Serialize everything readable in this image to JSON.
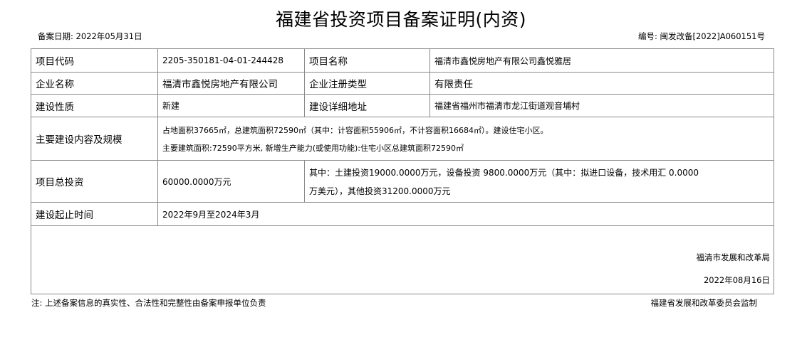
{
  "title": "福建省投资项目备案证明(内资)",
  "record_date": "备案日期:   2022年05月31日",
  "serial_no": "编号:   闽发改备[2022]A060151号",
  "labels": {
    "project_code": "项目代码",
    "project_name": "项目名称",
    "company_name": "企业名称",
    "company_type": "企业注册类型",
    "nature": "建设性质",
    "address": "建设详细地址",
    "content": "主要建设内容及规模",
    "investment": "项目总投资",
    "period": "建设起止时间"
  },
  "values": {
    "project_code": "2205-350181-04-01-244428",
    "project_name": "福清市鑫悦房地产有限公司鑫悦雅居",
    "company_name": "福清市鑫悦房地产有限公司",
    "company_type": "有限责任",
    "nature": "新建",
    "address": "福建省福州市福清市龙江街道观音埔村",
    "content_line1": "占地面积37665㎡，总建筑面积72590㎡（其中：计容面积55906㎡，不计容面积16684㎡）。建设住宅小区。",
    "content_line2": "主要建筑面积:72590平方米, 新增生产能力(或使用功能):住宅小区总建筑面积72590㎡",
    "investment_total": "60000.0000万元",
    "investment_detail_line1": "其中：土建投资19000.0000万元，设备投资 9800.0000万元（其中：拟进口设备，技术用汇 0.0000",
    "investment_detail_line2": "万美元），其他投资31200.0000万元",
    "period": "2022年9月至2024年3月"
  },
  "signature": {
    "org": "福清市发展和改革局",
    "date": "2022年08月16日"
  },
  "footer": {
    "note": "注:  上述备案信息的真实性、合法性和完整性由备案申报单位负责",
    "supervisor": "福建省发展和改革委员会监制"
  }
}
